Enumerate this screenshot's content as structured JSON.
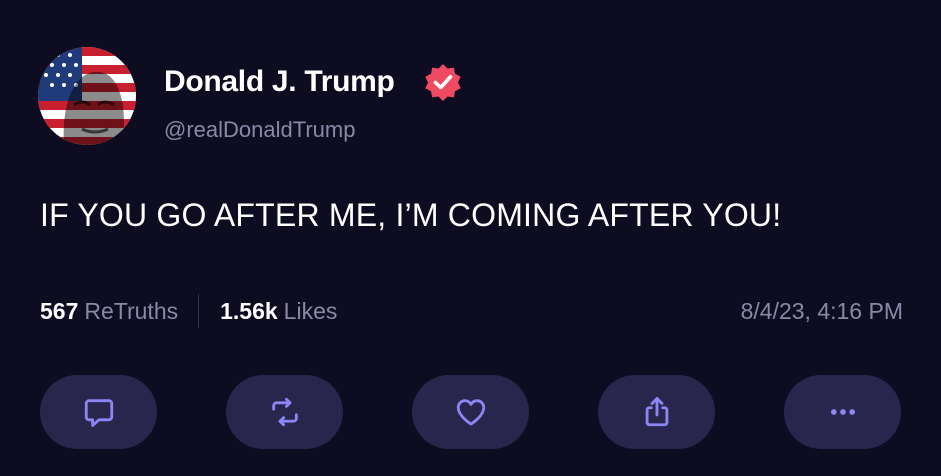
{
  "post": {
    "author": {
      "name": "Donald J. Trump",
      "handle": "@realDonaldTrump",
      "verified": true
    },
    "text": "IF YOU GO AFTER ME, I’M COMING AFTER YOU!",
    "stats": {
      "retruths_count": "567",
      "retruths_label": "ReTruths",
      "likes_count": "1.56k",
      "likes_label": "Likes"
    },
    "timestamp": "8/4/23, 4:16 PM"
  },
  "actions": [
    {
      "icon": "reply-icon"
    },
    {
      "icon": "retruth-icon"
    },
    {
      "icon": "heart-icon"
    },
    {
      "icon": "share-icon"
    },
    {
      "icon": "more-icon"
    }
  ],
  "colors": {
    "background": "#0e0c21",
    "secondary_text": "#8b88a6",
    "button_background": "#28264c",
    "icon_accent": "#8c86f5",
    "verified_badge": "#ee4b63"
  }
}
